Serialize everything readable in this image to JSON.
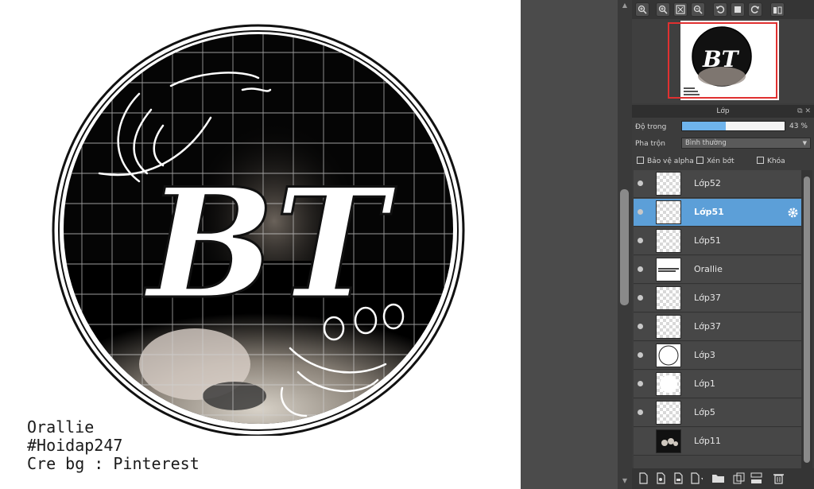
{
  "canvas": {
    "watermark_lines": [
      "Orallie",
      "#Hoidap247",
      "Cre bg : Pinterest"
    ]
  },
  "navigator_toolbar": {
    "icons": [
      "zoom-in-icon",
      "zoom-in-icon",
      "fit-screen-icon",
      "zoom-out-icon",
      "rotate-left-icon",
      "actual-size-icon",
      "rotate-right-icon",
      "flip-icon"
    ]
  },
  "layer_panel": {
    "title": "Lớp",
    "opacity_label": "Độ trong",
    "opacity_percent": 43,
    "opacity_text": "43 %",
    "blend_label": "Pha trộn",
    "blend_value": "Bình thường",
    "checkbox_alpha": "Bảo vệ alpha",
    "checkbox_clip": "Xén bớt",
    "checkbox_lock": "Khóa",
    "layers": [
      {
        "name": "Lớp52",
        "visible": true,
        "selected": false,
        "thumb": "transparent"
      },
      {
        "name": "Lớp51",
        "visible": true,
        "selected": true,
        "thumb": "transparent"
      },
      {
        "name": "Lớp51",
        "visible": true,
        "selected": false,
        "thumb": "transparent"
      },
      {
        "name": "Orallie",
        "visible": true,
        "selected": false,
        "thumb": "text"
      },
      {
        "name": "Lớp37",
        "visible": true,
        "selected": false,
        "thumb": "transparent"
      },
      {
        "name": "Lớp37",
        "visible": true,
        "selected": false,
        "thumb": "transparent"
      },
      {
        "name": "Lớp3",
        "visible": true,
        "selected": false,
        "thumb": "circle"
      },
      {
        "name": "Lớp1",
        "visible": true,
        "selected": false,
        "thumb": "white-circle"
      },
      {
        "name": "Lớp5",
        "visible": true,
        "selected": false,
        "thumb": "transparent"
      },
      {
        "name": "Lớp11",
        "visible": false,
        "selected": false,
        "thumb": "dark"
      }
    ]
  },
  "bottom_toolbar": {
    "icons": [
      "new-layer-icon",
      "new-halftone-layer-icon",
      "new-folder-layer-icon",
      "add-layer-menu-icon",
      "folder-icon",
      "duplicate-layer-icon",
      "merge-down-icon",
      "delete-layer-icon"
    ]
  },
  "colors": {
    "accent": "#5c9fd8",
    "opacity_fill": "#6fb4ec",
    "nav_frame": "#e03030"
  }
}
